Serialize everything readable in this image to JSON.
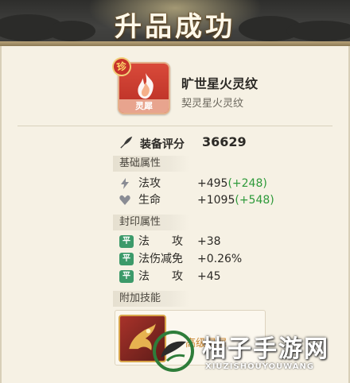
{
  "header": {
    "title": "升品成功"
  },
  "item": {
    "rarity_badge": "珍",
    "icon_tag": "灵犀",
    "name": "旷世星火灵纹",
    "subtitle": "契灵星火灵纹"
  },
  "score": {
    "label": "装备评分",
    "value": "36629",
    "icon": "quill-icon"
  },
  "base_attrs": {
    "title": "基础属性",
    "rows": [
      {
        "icon": "lightning-icon",
        "label": "法攻",
        "value": "+495",
        "bonus": "(+248)"
      },
      {
        "icon": "heart-icon",
        "label": "生命",
        "value": "+1095",
        "bonus": "(+548)"
      }
    ]
  },
  "seal_attrs": {
    "title": "封印属性",
    "badge": "平",
    "rows": [
      {
        "label": "法　　攻",
        "value": "+38"
      },
      {
        "label": "法伤减免",
        "value": "+0.26%"
      },
      {
        "label": "法　　攻",
        "value": "+45"
      }
    ]
  },
  "skills": {
    "title": "附加技能",
    "item_name": "高级灵犀"
  },
  "watermark": {
    "text": "柚子手游网",
    "sub": "XIUZISHOUYOUWANG"
  },
  "colors": {
    "bonus_green": "#2e9a3a",
    "seal_green": "#3c9a6a",
    "icon_red": "#c8352a"
  }
}
